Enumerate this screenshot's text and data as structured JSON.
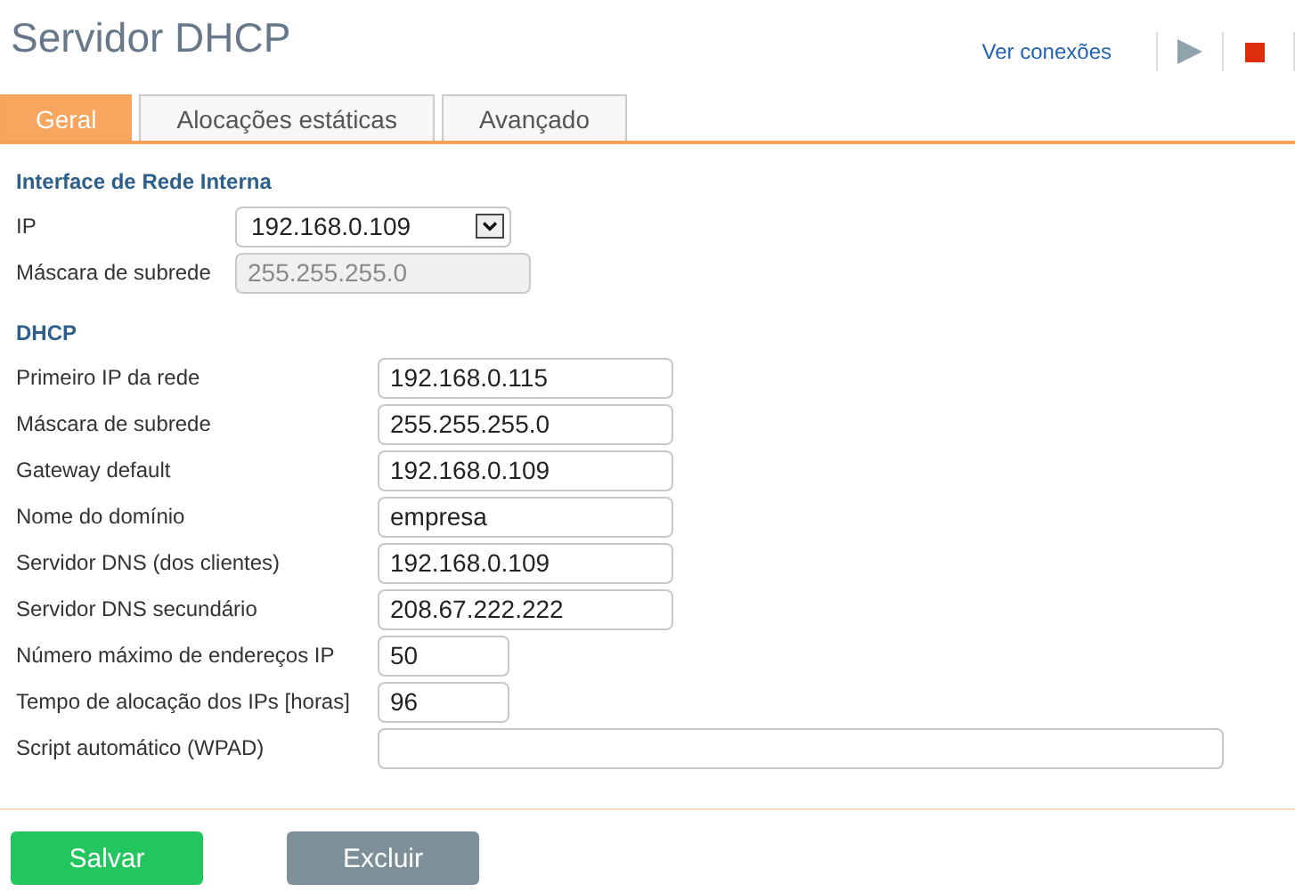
{
  "title": "Servidor DHCP",
  "header_link": "Ver conexões",
  "tabs": [
    {
      "label": "Geral",
      "selected": true
    },
    {
      "label": "Alocações estáticas",
      "selected": false
    },
    {
      "label": "Avançado",
      "selected": false
    }
  ],
  "sections": [
    {
      "heading": "Interface de Rede Interna",
      "fields": [
        {
          "label": "IP",
          "kind": "select",
          "value": "192.168.0.109",
          "disabled": false
        },
        {
          "label": "Máscara de subrede",
          "kind": "text",
          "value": "255.255.255.0",
          "disabled": true
        }
      ]
    },
    {
      "heading": "DHCP",
      "fields": [
        {
          "label": "Primeiro IP da rede",
          "kind": "text",
          "value": "192.168.0.115",
          "disabled": false
        },
        {
          "label": "Máscara de subrede",
          "kind": "text",
          "value": "255.255.255.0",
          "disabled": false
        },
        {
          "label": "Gateway default",
          "kind": "text",
          "value": "192.168.0.109",
          "disabled": false
        },
        {
          "label": "Nome do domínio",
          "kind": "text",
          "value": "empresa",
          "disabled": false
        },
        {
          "label": "Servidor DNS (dos clientes)",
          "kind": "text",
          "value": "192.168.0.109",
          "disabled": false
        },
        {
          "label": "Servidor DNS secundário",
          "kind": "text",
          "value": "208.67.222.222",
          "disabled": false
        },
        {
          "label": "Número máximo de endereços IP",
          "kind": "short",
          "value": "50",
          "disabled": false
        },
        {
          "label": "Tempo de alocação dos IPs [horas]",
          "kind": "short",
          "value": "96",
          "disabled": false
        },
        {
          "label": "Script automático (WPAD)",
          "kind": "long",
          "disabled": false
        }
      ]
    }
  ],
  "buttons": [
    {
      "label": "Salvar",
      "kind": "primary"
    },
    {
      "label": "Excluir",
      "kind": "secondary"
    }
  ]
}
